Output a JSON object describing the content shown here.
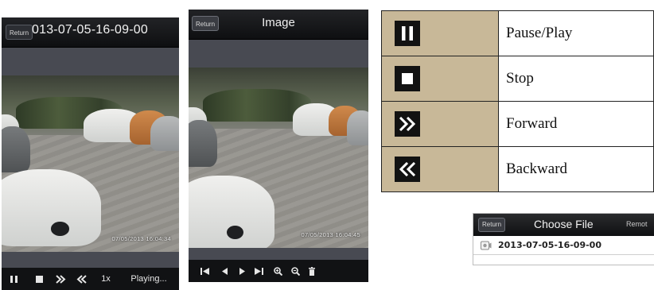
{
  "playback_screen": {
    "return_label": "Return",
    "title": "013-07-05-16-09-00",
    "osd_timestamp": "07/05/2013 16:04:34",
    "controls": [
      {
        "name": "pause-icon"
      },
      {
        "name": "stop-icon"
      },
      {
        "name": "forward-icon"
      },
      {
        "name": "backward-icon"
      }
    ],
    "speed": "1x",
    "status": "Playing..."
  },
  "image_screen": {
    "return_label": "Return",
    "title": "Image",
    "osd_timestamp": "07/05/2013 16:04:45",
    "toolbar": [
      "first-image-icon",
      "previous-image-icon",
      "next-image-icon",
      "last-image-icon",
      "zoom-in-icon",
      "zoom-out-icon",
      "delete-icon"
    ]
  },
  "legend": {
    "rows": [
      {
        "icon": "pause-play-icon",
        "label": "Pause/Play"
      },
      {
        "icon": "stop-icon",
        "label": "Stop"
      },
      {
        "icon": "forward-icon",
        "label": "Forward"
      },
      {
        "icon": "backward-icon",
        "label": "Backward"
      }
    ],
    "cell_color": "#c8b898"
  },
  "choose_file": {
    "return_label": "Return",
    "title": "Choose File",
    "remote_label": "Remot",
    "files": [
      {
        "name": "2013-07-05-16-09-00",
        "icon": "video-file-icon"
      }
    ]
  }
}
